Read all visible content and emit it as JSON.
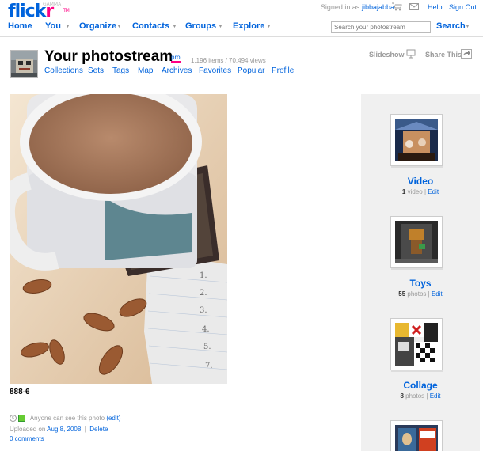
{
  "header": {
    "logo_flick": "flick",
    "logo_r": "r",
    "logo_beta": "GAMMA",
    "logo_tm": "TM",
    "signed_in_prefix": "Signed in as",
    "username": "jibbajabba",
    "help": "Help",
    "sign_out": "Sign Out"
  },
  "nav": {
    "items": [
      "Home",
      "You",
      "Organize",
      "Contacts",
      "Groups",
      "Explore"
    ],
    "search_placeholder": "Search your photostream",
    "search_label": "Search"
  },
  "profile": {
    "title": "Your photostream",
    "pro_badge": "pro",
    "counts": "1,196 items / 70,494 views",
    "subnav": [
      "Collections",
      "Sets",
      "Tags",
      "Map",
      "Archives",
      "Favorites",
      "Popular",
      "Profile"
    ],
    "slideshow": "Slideshow",
    "share_this": "Share This"
  },
  "photo": {
    "title": "888-6",
    "privacy_text": "Anyone can see this photo",
    "privacy_edit": "(edit)",
    "uploaded_prefix": "Uploaded on",
    "uploaded_date": "Aug 8, 2008",
    "delete": "Delete",
    "comments": "0 comments"
  },
  "sets": [
    {
      "title": "Video",
      "count": "1",
      "unit": "video",
      "edit": "Edit"
    },
    {
      "title": "Toys",
      "count": "55",
      "unit": "photos",
      "edit": "Edit"
    },
    {
      "title": "Collage",
      "count": "8",
      "unit": "photos",
      "edit": "Edit"
    },
    {
      "title": "",
      "count": "",
      "unit": "",
      "edit": ""
    }
  ],
  "colors": {
    "brand_blue": "#0063dc",
    "brand_pink": "#ff0084",
    "sidebar_bg": "#f0f0f0"
  }
}
